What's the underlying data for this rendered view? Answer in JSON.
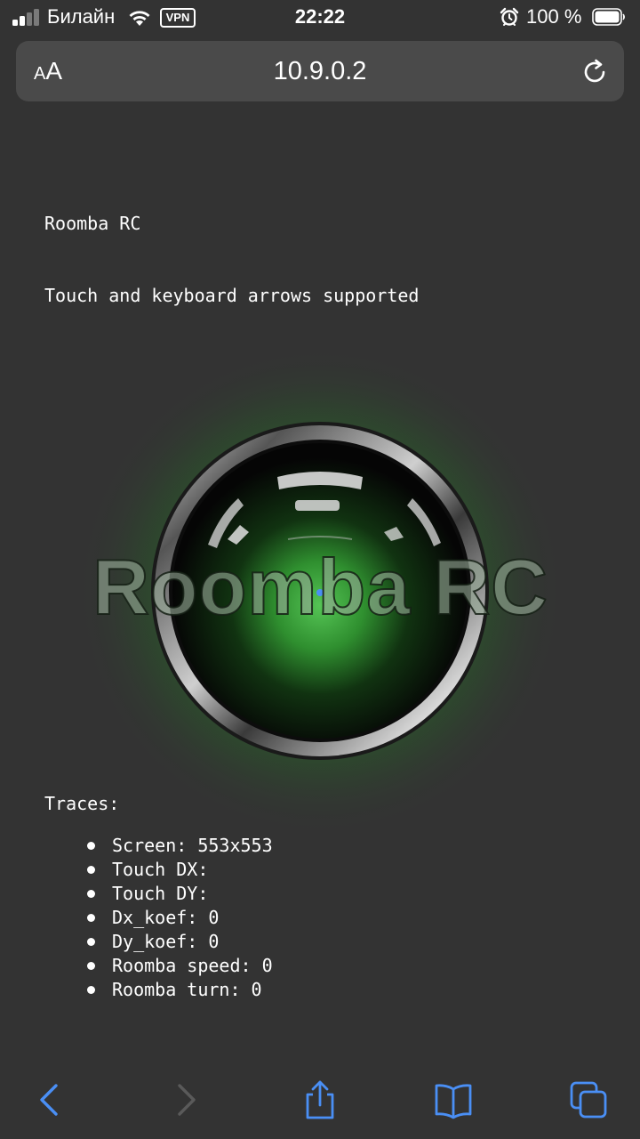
{
  "status_bar": {
    "carrier": "Билайн",
    "vpn_label": "VPN",
    "time": "22:22",
    "battery_text": "100 %"
  },
  "browser": {
    "text_size_small": "A",
    "text_size_big": "A",
    "url": "10.9.0.2"
  },
  "page": {
    "title": "Roomba RC",
    "subtitle": "Touch and keyboard arrows supported",
    "overlay_title": "Roomba RC",
    "traces_heading": "Traces:",
    "traces": [
      "Screen: 553x553",
      "Touch DX:",
      "Touch DY:",
      "Dx_koef: 0",
      "Dy_koef: 0",
      "Roomba speed: 0",
      "Roomba turn: 0"
    ]
  },
  "colors": {
    "background": "#333333",
    "accent_blue": "#4a8ff5",
    "glow_green": "#2e7d2e"
  },
  "icons": {
    "back": "chevron-left-icon",
    "forward": "chevron-right-icon",
    "share": "share-icon",
    "bookmarks": "book-icon",
    "tabs": "tabs-icon",
    "reload": "reload-icon"
  }
}
